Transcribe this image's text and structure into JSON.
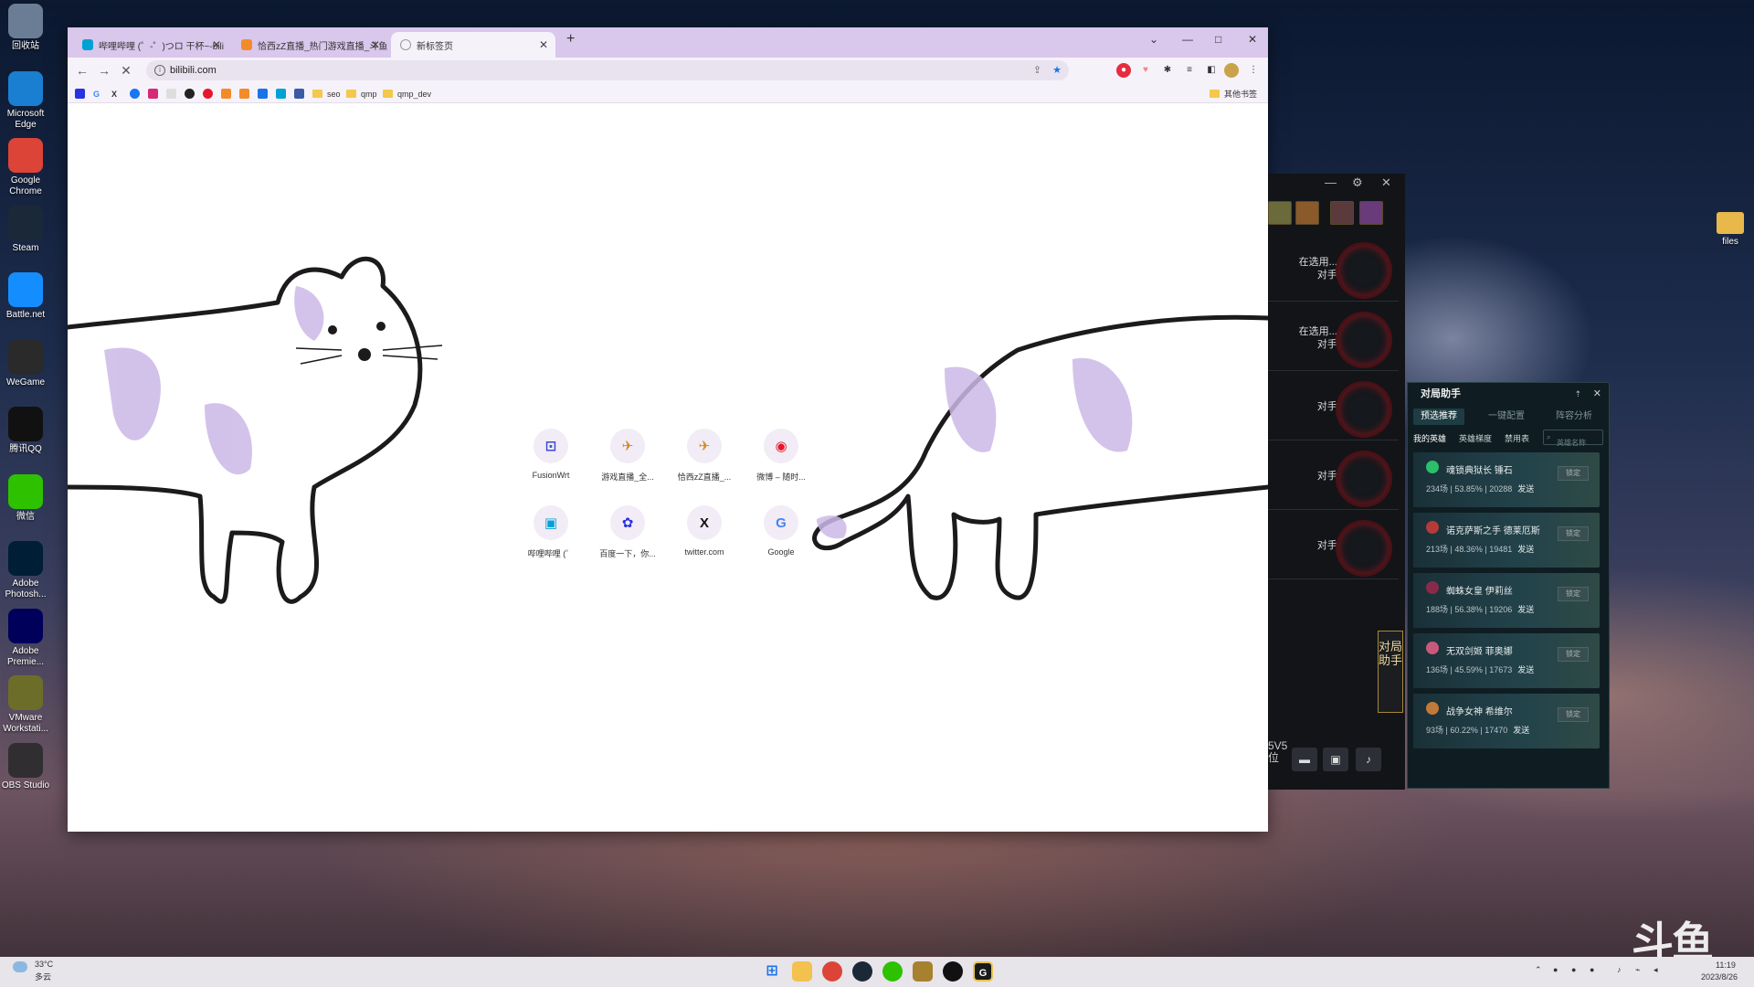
{
  "desktop": {
    "icons": [
      {
        "label": "回收站",
        "icon": "recycle-bin-icon",
        "color": "#6b7d94"
      },
      {
        "label": "Microsoft Edge",
        "icon": "edge-icon",
        "color": "#1a7fd0"
      },
      {
        "label": "Google Chrome",
        "icon": "chrome-icon",
        "color": "#db4437"
      },
      {
        "label": "Steam",
        "icon": "steam-icon",
        "color": "#1b2838"
      },
      {
        "label": "Battle.net",
        "icon": "battlenet-icon",
        "color": "#148eff"
      },
      {
        "label": "WeGame",
        "icon": "wegame-icon",
        "color": "#2a2a2a"
      },
      {
        "label": "腾讯QQ",
        "icon": "qq-icon",
        "color": "#111111"
      },
      {
        "label": "微信",
        "icon": "wechat-icon",
        "color": "#2dc100"
      },
      {
        "label": "Adobe Photosh...",
        "icon": "photoshop-icon",
        "color": "#001e36"
      },
      {
        "label": "Adobe Premie...",
        "icon": "premiere-icon",
        "color": "#00005b"
      },
      {
        "label": "VMware Workstati...",
        "icon": "vmware-icon",
        "color": "#6d6d2a"
      },
      {
        "label": "OBS Studio",
        "icon": "obs-icon",
        "color": "#302e31"
      }
    ],
    "right_icon_label": "files"
  },
  "browser": {
    "tabs": [
      {
        "title": "哔哩哔哩 (゜-゜)つロ 干杯~-bili",
        "active": false
      },
      {
        "title": "恰西zZ直播_热门游戏直播_斗鱼",
        "active": false
      },
      {
        "title": "新标签页",
        "active": true
      }
    ],
    "new_tab": "+",
    "url": "bilibili.com",
    "bookmarks": [
      {
        "label": "seo"
      },
      {
        "label": "qmp"
      },
      {
        "label": "qmp_dev"
      }
    ],
    "other_bookmarks": "其他书签",
    "shortcuts": [
      {
        "label": "FusionWrt",
        "glyph": "⊡",
        "color": "#3b4bd6"
      },
      {
        "label": "游戏直播_全...",
        "glyph": "✈",
        "color": "#d68a1b"
      },
      {
        "label": "恰西zZ直播_...",
        "glyph": "✈",
        "color": "#d68a1b"
      },
      {
        "label": "微博 – 随时...",
        "glyph": "◉",
        "color": "#e6162d"
      },
      {
        "label": "哔哩哔哩 (゜",
        "glyph": "▣",
        "color": "#00a1d6"
      },
      {
        "label": "百度一下，你...",
        "glyph": "✿",
        "color": "#2932e1"
      },
      {
        "label": "twitter.com",
        "glyph": "X",
        "color": "#111111"
      },
      {
        "label": "Google",
        "glyph": "G",
        "color": "#4285f4"
      }
    ]
  },
  "game_panel": {
    "slots": [
      {
        "line1": "在选用......",
        "line2": "对手 1"
      },
      {
        "line1": "在选用......",
        "line2": "对手 2"
      },
      {
        "line1": "",
        "line2": "对手 3"
      },
      {
        "line1": "",
        "line2": "对手 4"
      },
      {
        "line1": "",
        "line2": "对手 5"
      }
    ],
    "side_tab": "对局助手",
    "bottom_label": "5V5 位"
  },
  "assistant": {
    "title": "对局助手",
    "tabs": [
      "预选推荐",
      "一键配置",
      "阵容分析"
    ],
    "subtabs": [
      "我的英雄",
      "英雄梯度",
      "禁用表"
    ],
    "search_placeholder": "英雄名称",
    "heroes": [
      {
        "name": "魂锁典狱长 锤石",
        "stats": "234场 | 53.85% | 20288",
        "send": "发送",
        "lock": "锁定",
        "color": "#2bbf6a"
      },
      {
        "name": "诺克萨斯之手 德莱厄斯",
        "stats": "213场 | 48.36% | 19481",
        "send": "发送",
        "lock": "锁定",
        "color": "#b53a3a"
      },
      {
        "name": "蜘蛛女皇 伊莉丝",
        "stats": "188场 | 56.38% | 19206",
        "send": "发送",
        "lock": "锁定",
        "color": "#8a2a4a"
      },
      {
        "name": "无双剑姬 菲奥娜",
        "stats": "136场 | 45.59% | 17673",
        "send": "发送",
        "lock": "锁定",
        "color": "#c9587a"
      },
      {
        "name": "战争女神 希维尔",
        "stats": "93场 | 60.22% | 17470",
        "send": "发送",
        "lock": "锁定",
        "color": "#c07a3a"
      }
    ]
  },
  "taskbar": {
    "weather_temp": "33°C",
    "weather_desc": "多云",
    "time": "11:19",
    "date": "2023/8/26"
  },
  "watermark": "斗鱼"
}
